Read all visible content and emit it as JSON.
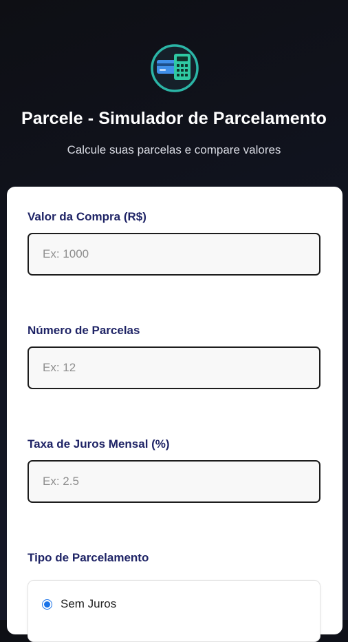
{
  "header": {
    "logo_icon": "credit-card-calculator-icon",
    "title": "Parcele - Simulador de Parcelamento",
    "subtitle": "Calcule suas parcelas e compare valores"
  },
  "form": {
    "purchase_value": {
      "label": "Valor da Compra (R$)",
      "value": "",
      "placeholder": "Ex: 1000"
    },
    "installments": {
      "label": "Número de Parcelas",
      "value": "",
      "placeholder": "Ex: 12"
    },
    "interest_rate": {
      "label": "Taxa de Juros Mensal (%)",
      "value": "",
      "placeholder": "Ex: 2.5"
    },
    "installment_type": {
      "label": "Tipo de Parcelamento",
      "options": [
        {
          "label": "Sem Juros",
          "selected": true
        }
      ]
    }
  },
  "colors": {
    "accent_teal": "#2bb5a6",
    "label_navy": "#1f2466",
    "radio_blue": "#1a73e8",
    "background_dark": "#111420"
  }
}
